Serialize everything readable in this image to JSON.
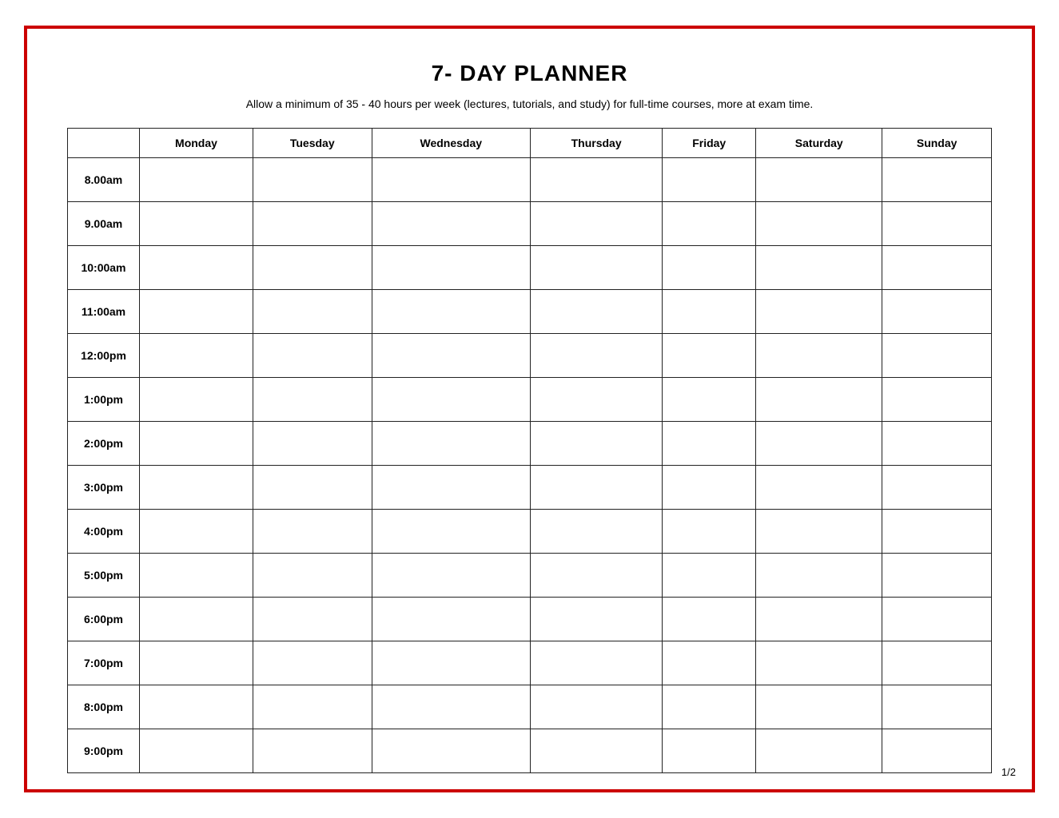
{
  "page": {
    "title": "7- DAY PLANNER",
    "subtitle": "Allow a minimum of 35 - 40 hours per week (lectures, tutorials, and study) for full-time courses, more at exam time.",
    "page_number": "1/2"
  },
  "table": {
    "headers": [
      "",
      "Monday",
      "Tuesday",
      "Wednesday",
      "Thursday",
      "Friday",
      "Saturday",
      "Sunday"
    ],
    "time_slots": [
      "8.00am",
      "9.00am",
      "10:00am",
      "11:00am",
      "12:00pm",
      "1:00pm",
      "2:00pm",
      "3:00pm",
      "4:00pm",
      "5:00pm",
      "6:00pm",
      "7:00pm",
      "8:00pm",
      "9:00pm"
    ]
  }
}
